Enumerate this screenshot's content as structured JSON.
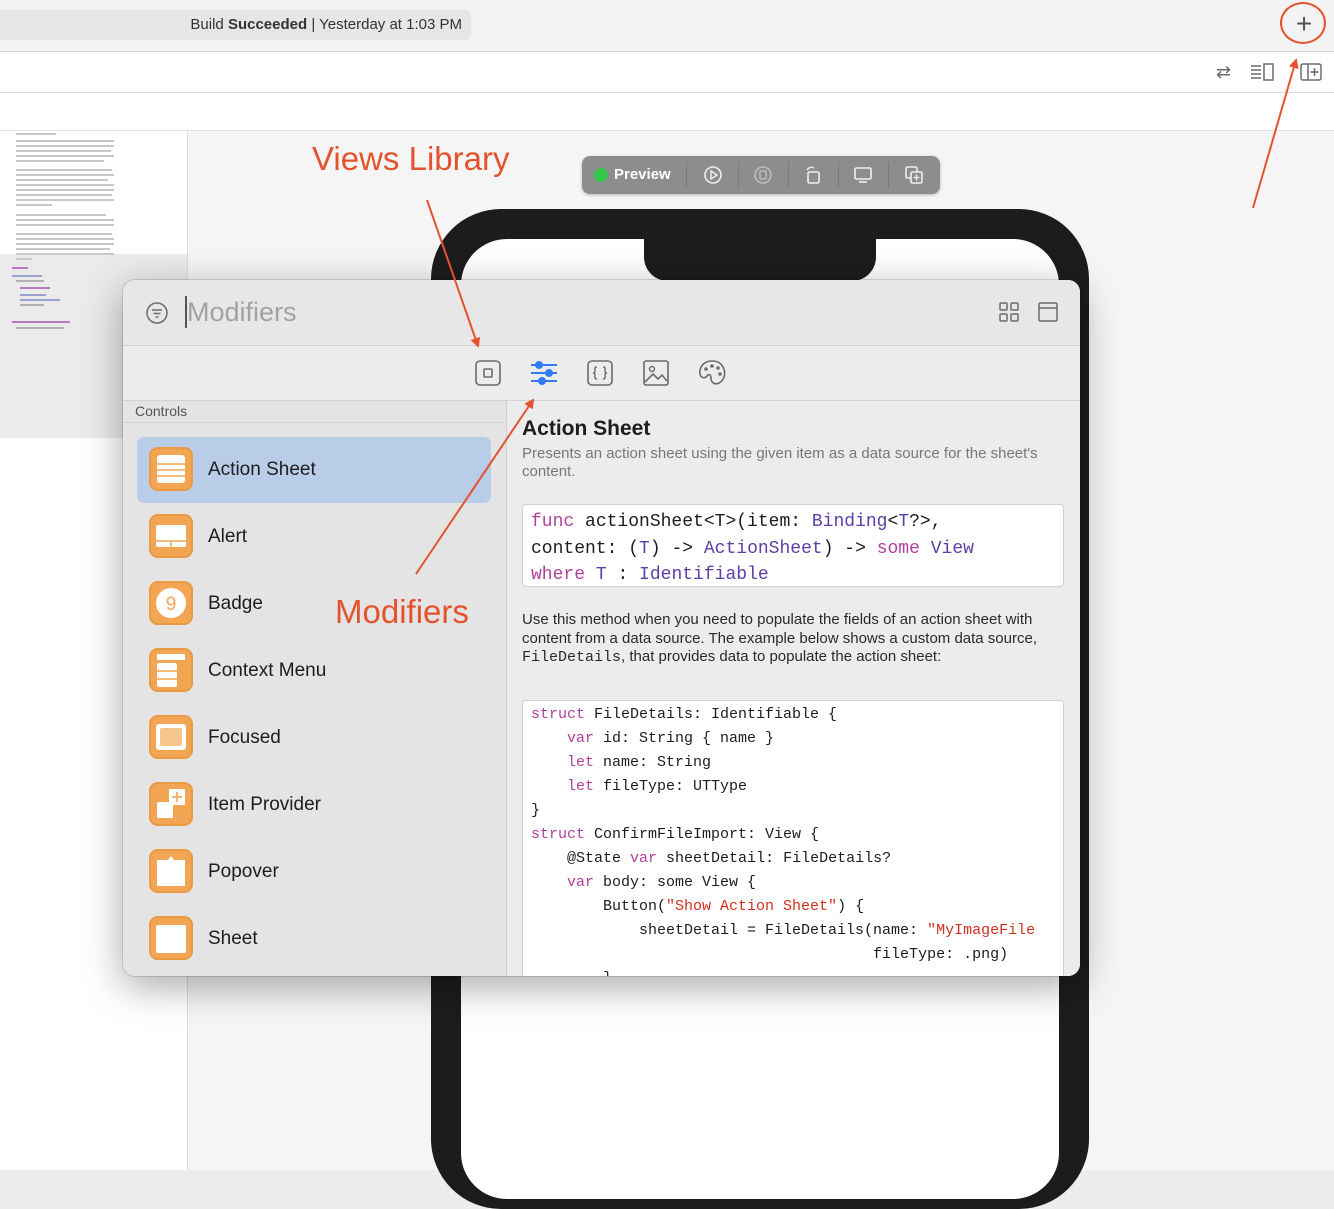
{
  "toolbar": {
    "status_prefix": "Build ",
    "status_strong": "Succeeded",
    "status_suffix": " | Yesterday at 1:03 PM",
    "add_label": "+",
    "icons": [
      "swap-icon",
      "inspector-list-icon",
      "add-editor-icon"
    ]
  },
  "preview": {
    "label": "Preview",
    "icons": [
      "live-play-icon",
      "stop-icon",
      "rotate-icon",
      "device-icon",
      "duplicate-icon"
    ]
  },
  "library": {
    "search_placeholder": "Modifiers",
    "tabs": [
      "views-tab",
      "modifiers-tab",
      "snippets-tab",
      "media-tab",
      "colors-tab"
    ],
    "section_label": "Controls",
    "items": [
      {
        "label": "Action Sheet",
        "icon": "action-sheet-icon"
      },
      {
        "label": "Alert",
        "icon": "alert-icon"
      },
      {
        "label": "Badge",
        "icon": "badge-icon"
      },
      {
        "label": "Context Menu",
        "icon": "context-menu-icon"
      },
      {
        "label": "Focused",
        "icon": "focused-icon"
      },
      {
        "label": "Item Provider",
        "icon": "item-provider-icon"
      },
      {
        "label": "Popover",
        "icon": "popover-icon"
      },
      {
        "label": "Sheet",
        "icon": "sheet-icon"
      }
    ],
    "badge_glyph": "9",
    "detail": {
      "title": "Action Sheet",
      "summary": "Presents an action sheet using the given item as a data source for the sheet's content.",
      "signature": {
        "l1a": "func",
        "l1b": " actionSheet<T>(item: ",
        "l1c": "Binding",
        "l1d": "<",
        "l1e": "T",
        "l1f": "?>,",
        "l2a": "content: (",
        "l2b": "T",
        "l2c": ") -> ",
        "l2d": "ActionSheet",
        "l2e": ") -> ",
        "l2f": "some",
        "l2g": " ",
        "l2h": "View",
        "l3a": "where",
        "l3b": " ",
        "l3c": "T",
        "l3d": " : ",
        "l3e": "Identifiable"
      },
      "body_a": "Use this method when you need to populate the fields of an action sheet with content from a data source. The example below shows a custom data source, ",
      "body_code": "FileDetails",
      "body_b": ", that provides data to populate the action sheet:",
      "code": {
        "c1a": "struct",
        "c1b": " FileDetails: Identifiable {",
        "c2a": "    var",
        "c2b": " id: String { name }",
        "c3a": "    let",
        "c3b": " name: String",
        "c4a": "    let",
        "c4b": " fileType: UTType",
        "c5": "}",
        "c6a": "struct",
        "c6b": " ConfirmFileImport: View {",
        "c7a": "    @State ",
        "c7b": "var",
        "c7c": " sheetDetail: FileDetails?",
        "c8a": "    var",
        "c8b": " body: some View {",
        "c9a": "        Button(",
        "c9b": "\"Show Action Sheet\"",
        "c9c": ") {",
        "c10a": "            sheetDetail = FileDetails(name: ",
        "c10b": "\"MyImageFile",
        "c11": "                                      fileType: .png)",
        "c12": "        }"
      }
    }
  },
  "annotations": {
    "views_library": "Views Library",
    "modifiers": "Modifiers"
  },
  "colors": {
    "annotation": "#e5532d",
    "selected_row": "#b9cde8",
    "item_icon": "#f2a654",
    "keyword": "#b43f9d",
    "type": "#5b3ea8",
    "string": "#d12f1b",
    "preview_live": "#33c44a"
  }
}
